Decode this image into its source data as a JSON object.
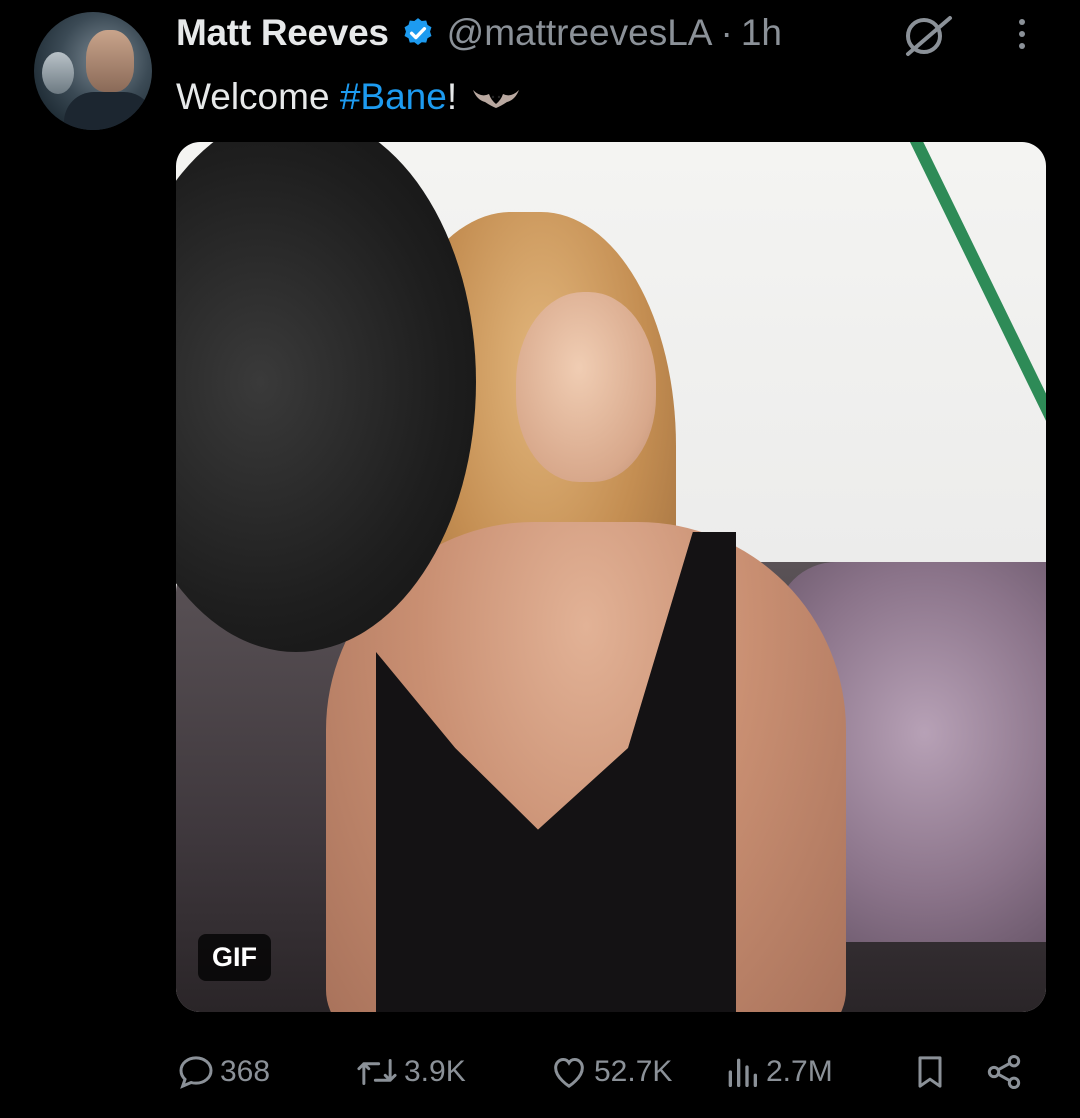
{
  "author": {
    "name": "Matt Reeves",
    "handle": "@mattreevesLA",
    "separator": "·",
    "time": "1h",
    "verified": true
  },
  "tweet": {
    "text_before": "Welcome ",
    "hashtag": "#Bane",
    "text_after": "!",
    "emoji": "bat-emoji"
  },
  "media": {
    "type": "gif",
    "badge": "GIF"
  },
  "actions": {
    "replies": "368",
    "reposts": "3.9K",
    "likes": "52.7K",
    "views": "2.7M"
  },
  "colors": {
    "background": "#000000",
    "text": "#e7e9ea",
    "muted": "#8b9198",
    "accent": "#1d9bf0"
  }
}
